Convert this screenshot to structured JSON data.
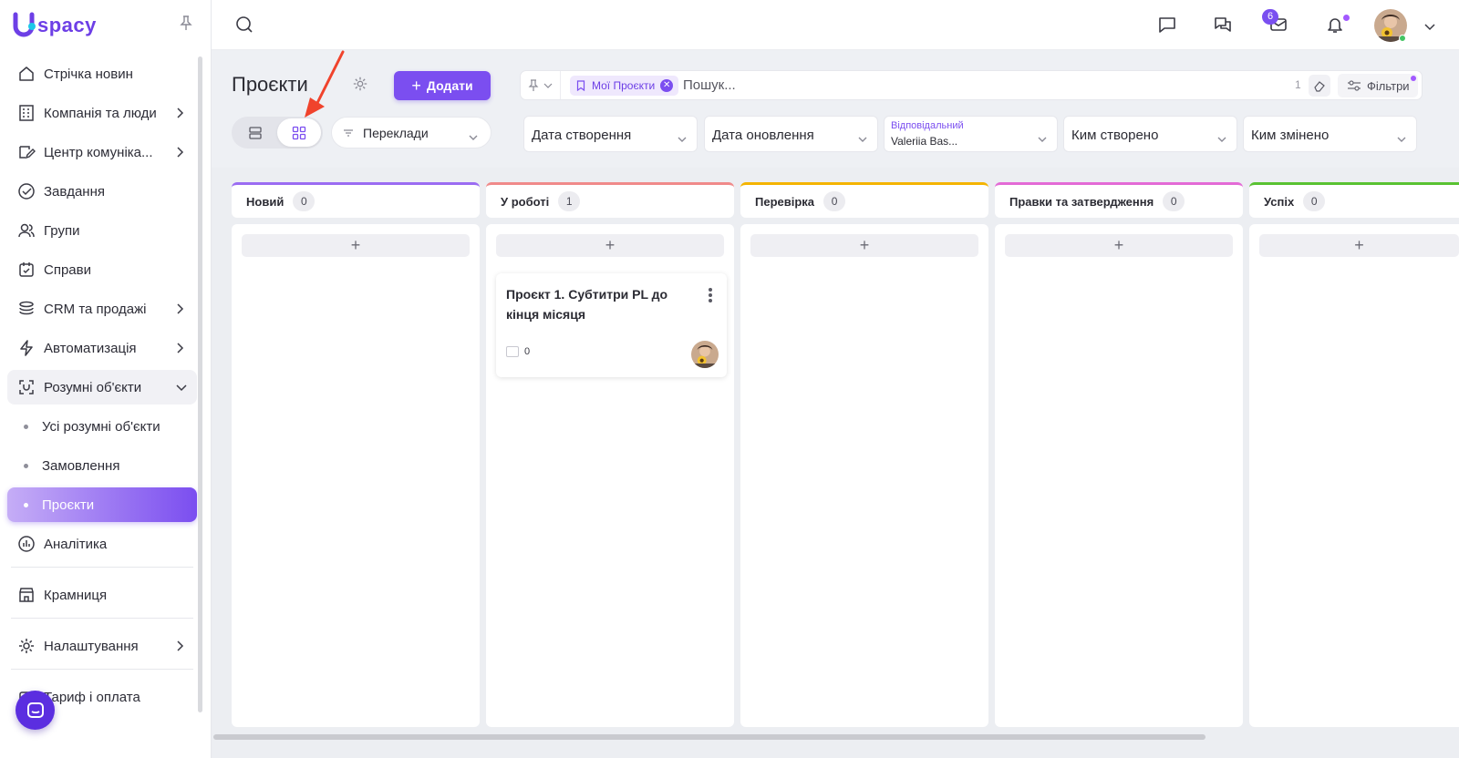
{
  "logo": {
    "text": "spacy"
  },
  "sidebar": {
    "items": [
      {
        "label": "Стрічка новин",
        "icon": "home-icon"
      },
      {
        "label": "Компанія та люди",
        "icon": "building-icon",
        "has_arrow": true
      },
      {
        "label": "Центр комуніка...",
        "icon": "chat-edit-icon",
        "has_arrow": true
      },
      {
        "label": "Завдання",
        "icon": "check-circle-icon"
      },
      {
        "label": "Групи",
        "icon": "users-icon"
      },
      {
        "label": "Справи",
        "icon": "calendar-check-icon"
      },
      {
        "label": "CRM та продажі",
        "icon": "stack-icon",
        "has_arrow": true
      },
      {
        "label": "Автоматизація",
        "icon": "lightning-icon",
        "has_arrow": true
      },
      {
        "label": "Розумні об'єкти",
        "icon": "smart-object-icon",
        "expanded": true
      }
    ],
    "subitems": [
      {
        "label": "Усі розумні об'єкти"
      },
      {
        "label": "Замовлення"
      },
      {
        "label": "Проєкти",
        "active": true
      }
    ],
    "items_after": [
      {
        "label": "Аналітика",
        "icon": "chart-circle-icon"
      },
      {
        "label": "Крамниця",
        "icon": "store-icon"
      },
      {
        "label": "Налаштування",
        "icon": "gear-icon",
        "has_arrow": true
      },
      {
        "label": "Тариф і оплата",
        "icon": "wallet-icon"
      }
    ]
  },
  "topbar": {
    "mail_badge": "6"
  },
  "header": {
    "title": "Проєкти",
    "add_label": "Додати",
    "pipeline": "Переклади"
  },
  "search": {
    "chip": "Мої Проєкти",
    "placeholder": "Пошук...",
    "count": "1",
    "filters_label": "Фільтри"
  },
  "filters": [
    {
      "label": "Дата створення"
    },
    {
      "label": "Дата оновлення"
    },
    {
      "small_label": "Відповідальний",
      "value": "Valeriia Bas..."
    },
    {
      "label": "Ким створено"
    },
    {
      "label": "Ким змінено"
    }
  ],
  "columns": [
    {
      "title": "Новий",
      "count": "0",
      "color": "#9b6cf2"
    },
    {
      "title": "У роботі",
      "count": "1",
      "color": "#f08a8a"
    },
    {
      "title": "Перевірка",
      "count": "0",
      "color": "#f4b400"
    },
    {
      "title": "Правки та затвердження",
      "count": "0",
      "color": "#e36bd6"
    },
    {
      "title": "Успіх",
      "count": "0",
      "color": "#59c232"
    }
  ],
  "card": {
    "title": "Проєкт 1. Субтитри PL до кінця місяця",
    "count": "0"
  },
  "colors": {
    "accent": "#7b4ef0",
    "sidebar_active": "#8d5cf3"
  }
}
